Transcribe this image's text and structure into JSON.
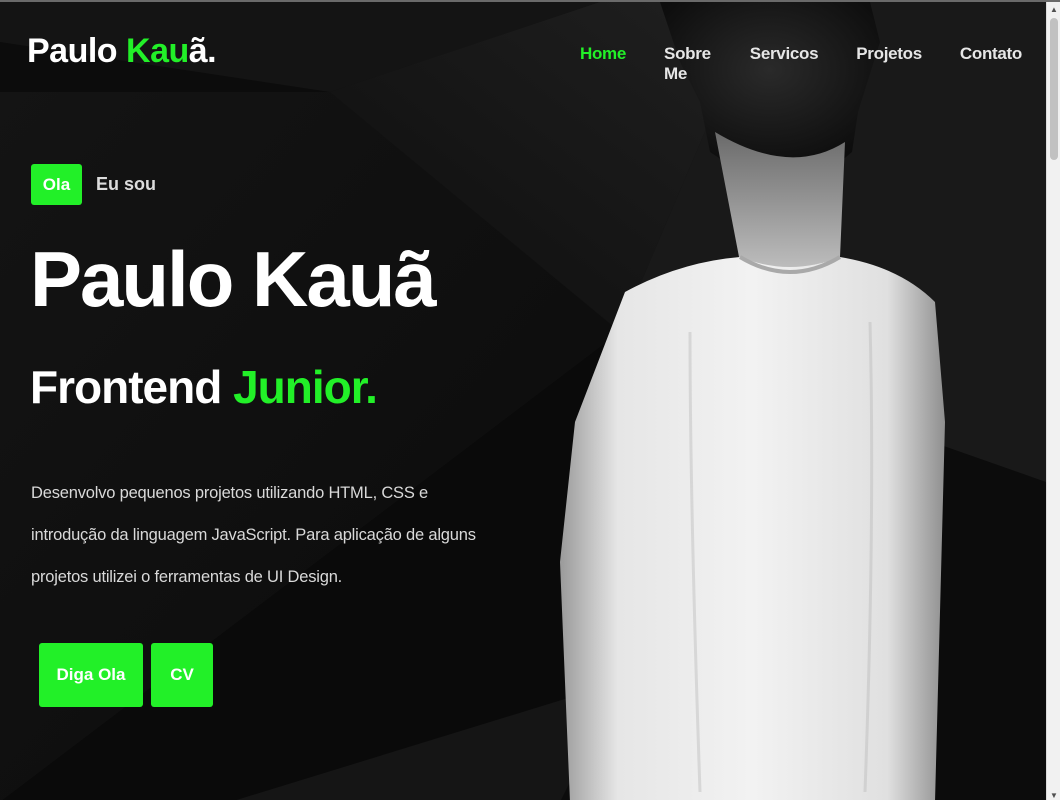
{
  "header": {
    "logo_main": "Paulo ",
    "logo_accent": "Kau",
    "logo_tail": "ã."
  },
  "nav": {
    "items": [
      {
        "label": "Home",
        "active": true
      },
      {
        "label": "Sobre Me",
        "active": false
      },
      {
        "label": "Servicos",
        "active": false
      },
      {
        "label": "Projetos",
        "active": false
      },
      {
        "label": "Contato",
        "active": false
      }
    ]
  },
  "hero": {
    "badge": "Ola",
    "intro": "Eu sou",
    "name": "Paulo Kauã",
    "role_main": "Frontend ",
    "role_accent": "Junior.",
    "description": "Desenvolvo pequenos projetos utilizando HTML, CSS e introdução da linguagem JavaScript. Para aplicação de alguns projetos utilizei o ferramentas de UI Design.",
    "buttons": {
      "hello": "Diga Ola",
      "cv": "CV"
    }
  },
  "colors": {
    "accent": "#22f028",
    "background": "#0c0c0c",
    "text": "#ffffff"
  },
  "icons": {
    "scroll_up": "arrow-up-icon",
    "scroll_down": "arrow-down-icon"
  }
}
